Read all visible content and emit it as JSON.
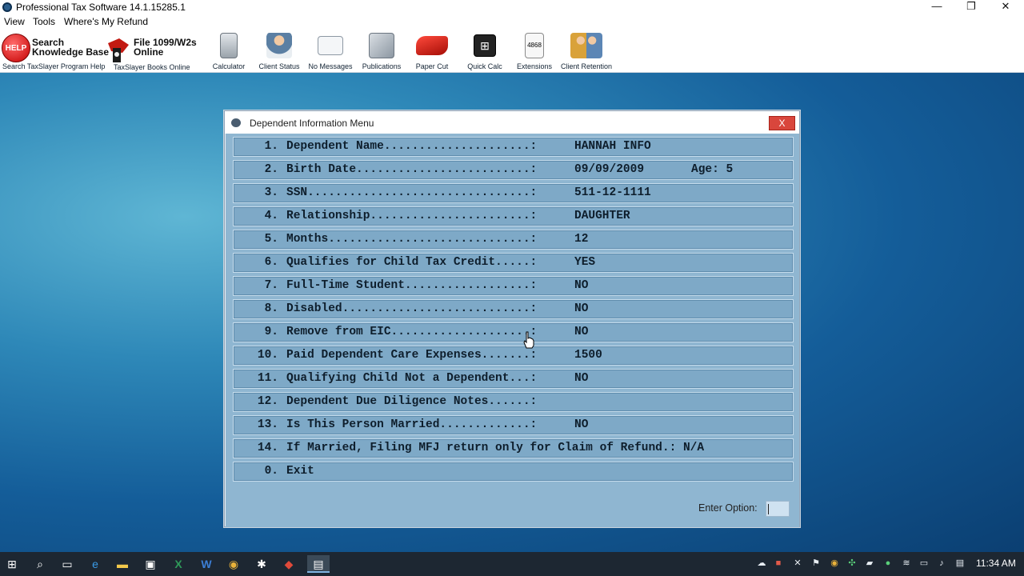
{
  "window": {
    "title": "Professional Tax Software 14.1.15285.1",
    "controls": {
      "minimize": "—",
      "restore": "❐",
      "close": "✕"
    }
  },
  "menu": [
    "View",
    "Tools",
    "Where's My Refund"
  ],
  "toolbar": {
    "help": {
      "badge": "HELP",
      "title_line1": "Search",
      "title_line2": "Knowledge Base",
      "sub": "Search TaxSlayer Program Help"
    },
    "file": {
      "title_line1": "File 1099/W2s",
      "title_line2": "Online",
      "sub": "TaxSlayer Books Online"
    },
    "buttons": [
      {
        "label": "Calculator",
        "icon": "calculator-icon"
      },
      {
        "label": "Client Status",
        "icon": "client-status-icon"
      },
      {
        "label": "No Messages",
        "icon": "envelope-icon"
      },
      {
        "label": "Publications",
        "icon": "publications-icon"
      },
      {
        "label": "Paper Cut",
        "icon": "paper-cut-icon"
      },
      {
        "label": "Quick Calc",
        "icon": "quick-calc-icon"
      },
      {
        "label": "Extensions",
        "icon": "extensions-icon",
        "icon_text": "4868"
      },
      {
        "label": "Client Retention",
        "icon": "client-retention-icon"
      }
    ]
  },
  "dialog": {
    "title": "Dependent Information Menu",
    "close": "X",
    "options": [
      {
        "n": "1.",
        "label": "Dependent Name.....................:",
        "value": "HANNAH INFO",
        "extra": ""
      },
      {
        "n": "2.",
        "label": "Birth Date.........................:",
        "value": "09/09/2009",
        "extra": "Age: 5"
      },
      {
        "n": "3.",
        "label": "SSN................................:",
        "value": "511-12-1111",
        "extra": ""
      },
      {
        "n": "4.",
        "label": "Relationship.......................:",
        "value": "DAUGHTER",
        "extra": ""
      },
      {
        "n": "5.",
        "label": "Months.............................:",
        "value": "12",
        "extra": ""
      },
      {
        "n": "6.",
        "label": "Qualifies for Child Tax Credit.....:",
        "value": "YES",
        "extra": ""
      },
      {
        "n": "7.",
        "label": "Full-Time Student..................:",
        "value": "NO",
        "extra": ""
      },
      {
        "n": "8.",
        "label": "Disabled...........................:",
        "value": "NO",
        "extra": ""
      },
      {
        "n": "9.",
        "label": "Remove from EIC....................:",
        "value": "NO",
        "extra": ""
      },
      {
        "n": "10.",
        "label": "Paid Dependent Care Expenses.......:",
        "value": "1500",
        "extra": ""
      },
      {
        "n": "11.",
        "label": "Qualifying Child Not a Dependent...:",
        "value": "NO",
        "extra": ""
      },
      {
        "n": "12.",
        "label": "Dependent Due Diligence Notes......:",
        "value": "",
        "extra": ""
      },
      {
        "n": "13.",
        "label": "Is This Person Married.............:",
        "value": "NO",
        "extra": ""
      },
      {
        "n": "14.",
        "label": "If Married, Filing MFJ return only for Claim of Refund.: N/A",
        "value": "",
        "extra": ""
      },
      {
        "n": "0.",
        "label": "Exit",
        "value": "",
        "extra": ""
      }
    ],
    "enter_label": "Enter Option:",
    "enter_value": ""
  },
  "taskbar": {
    "apps": [
      "start-icon",
      "search-icon",
      "task-view-icon",
      "edge-icon",
      "file-explorer-icon",
      "store-icon",
      "excel-icon",
      "word-icon",
      "chrome-icon",
      "app-icon",
      "app-icon-2",
      "tax-software-icon"
    ],
    "clock": "11:34 AM"
  },
  "colors": {
    "desktop": "#145d99",
    "option_bar": "#7ea9c7",
    "dialog_body": "#8fb6d1",
    "close_button": "#d9463c"
  }
}
